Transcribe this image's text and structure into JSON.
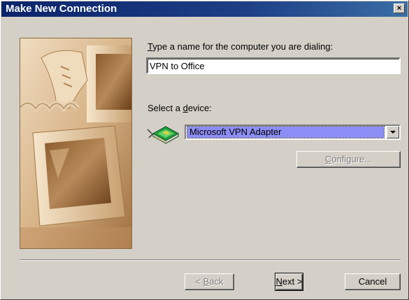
{
  "window": {
    "title": "Make New Connection",
    "close_glyph": "×"
  },
  "form": {
    "name_label_accel": "T",
    "name_label_rest": "ype a name for the computer you are dialing:",
    "name_value": "VPN to Office",
    "device_label_pre": "Select a ",
    "device_label_accel": "d",
    "device_label_post": "evice:",
    "device_icon": "network-adapter-icon",
    "device_selected": "Microsoft VPN Adapter",
    "configure_accel": "C",
    "configure_rest": "onfigure...",
    "configure_enabled": false
  },
  "footer": {
    "back_pre": "< ",
    "back_accel": "B",
    "back_rest": "ack",
    "back_enabled": false,
    "next_accel": "N",
    "next_rest": "ext >",
    "cancel_label": "Cancel"
  },
  "colors": {
    "title_bar": "#0a246a",
    "selection": "#8d8ef5",
    "face": "#d4d0c8"
  }
}
